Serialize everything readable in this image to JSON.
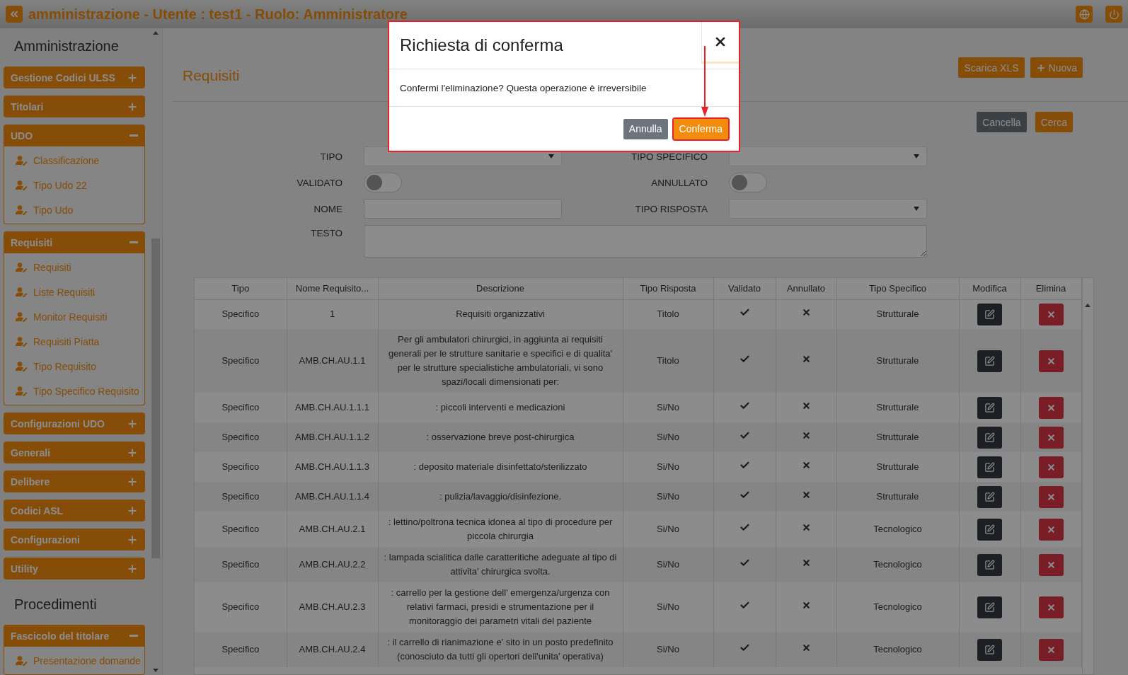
{
  "header": {
    "title": "amministrazione - Utente : test1 - Ruolo: Amministratore"
  },
  "sidebar": {
    "sections": [
      {
        "heading": "Amministrazione",
        "groups": [
          {
            "label": "Gestione Codici ULSS",
            "expanded": false
          },
          {
            "label": "Titolari",
            "expanded": false
          },
          {
            "label": "UDO",
            "expanded": true,
            "items": [
              "Classificazione",
              "Tipo Udo 22",
              "Tipo Udo"
            ]
          },
          {
            "label": "Requisiti",
            "expanded": true,
            "items": [
              "Requisiti",
              "Liste Requisiti",
              "Monitor Requisiti",
              "Requisiti Piatta",
              "Tipo Requisito",
              "Tipo Specifico Requisito"
            ]
          },
          {
            "label": "Configurazioni UDO",
            "expanded": false
          },
          {
            "label": "Generali",
            "expanded": false
          },
          {
            "label": "Delibere",
            "expanded": false
          },
          {
            "label": "Codici ASL",
            "expanded": false
          },
          {
            "label": "Configurazioni",
            "expanded": false
          },
          {
            "label": "Utility",
            "expanded": false
          }
        ]
      },
      {
        "heading": "Procedimenti",
        "groups": [
          {
            "label": "Fascicolo del titolare",
            "expanded": true,
            "items": [
              "Presentazione domande"
            ]
          }
        ]
      }
    ]
  },
  "page": {
    "title": "Requisiti",
    "actions": [
      {
        "label": "Scarica XLS",
        "kind": "plain"
      },
      {
        "label": "Nuova",
        "kind": "add"
      }
    ],
    "filter_actions": [
      {
        "label": "Cancella",
        "kind": "secondary"
      },
      {
        "label": "Cerca",
        "kind": "primary"
      }
    ],
    "filters": [
      {
        "label": "TIPO",
        "kind": "select"
      },
      {
        "label": "TIPO SPECIFICO",
        "kind": "select"
      },
      {
        "label": "VALIDATO",
        "kind": "toggle",
        "on": false
      },
      {
        "label": "ANNULLATO",
        "kind": "toggle",
        "on": false
      },
      {
        "label": "NOME",
        "kind": "text"
      },
      {
        "label": "TIPO RISPOSTA",
        "kind": "select"
      },
      {
        "label": "TESTO",
        "kind": "textarea"
      }
    ]
  },
  "table": {
    "columns": [
      "Tipo",
      "Nome Requisito...",
      "Descrizione",
      "Tipo Risposta",
      "Validato",
      "Annullato",
      "Tipo Specifico",
      "Modifica",
      "Elimina"
    ],
    "rows": [
      {
        "tipo": "Specifico",
        "nome": "1",
        "descrizione": "Requisiti organizzativi",
        "tipo_risposta": "Titolo",
        "validato": true,
        "annullato": false,
        "tipo_specifico": "Strutturale"
      },
      {
        "tipo": "Specifico",
        "nome": "AMB.CH.AU.1.1",
        "descrizione": "Per gli ambulatori chirurgici, in aggiunta ai requisiti generali per le strutture sanitarie e specifici e di qualita' per le strutture specialistiche ambulatoriali, vi sono spazi/locali dimensionati per:",
        "tipo_risposta": "Titolo",
        "validato": true,
        "annullato": false,
        "tipo_specifico": "Strutturale"
      },
      {
        "tipo": "Specifico",
        "nome": "AMB.CH.AU.1.1.1",
        "descrizione": ": piccoli interventi e medicazioni",
        "tipo_risposta": "Si/No",
        "validato": true,
        "annullato": false,
        "tipo_specifico": "Strutturale"
      },
      {
        "tipo": "Specifico",
        "nome": "AMB.CH.AU.1.1.2",
        "descrizione": ": osservazione breve post-chirurgica",
        "tipo_risposta": "Si/No",
        "validato": true,
        "annullato": false,
        "tipo_specifico": "Strutturale"
      },
      {
        "tipo": "Specifico",
        "nome": "AMB.CH.AU.1.1.3",
        "descrizione": ": deposito materiale disinfettato/sterilizzato",
        "tipo_risposta": "Si/No",
        "validato": true,
        "annullato": false,
        "tipo_specifico": "Strutturale"
      },
      {
        "tipo": "Specifico",
        "nome": "AMB.CH.AU.1.1.4",
        "descrizione": ": pulizia/lavaggio/disinfezione.",
        "tipo_risposta": "Si/No",
        "validato": true,
        "annullato": false,
        "tipo_specifico": "Strutturale"
      },
      {
        "tipo": "Specifico",
        "nome": "AMB.CH.AU.2.1",
        "descrizione": ": lettino/poltrona tecnica idonea al tipo di procedure per piccola chirurgia",
        "tipo_risposta": "Si/No",
        "validato": true,
        "annullato": false,
        "tipo_specifico": "Tecnologico"
      },
      {
        "tipo": "Specifico",
        "nome": "AMB.CH.AU.2.2",
        "descrizione": ": lampada scialitica dalle caratteritiche adeguate al tipo di attivita' chirurgica svolta.",
        "tipo_risposta": "Si/No",
        "validato": true,
        "annullato": false,
        "tipo_specifico": "Tecnologico"
      },
      {
        "tipo": "Specifico",
        "nome": "AMB.CH.AU.2.3",
        "descrizione": ": carrello per la gestione dell' emergenza/urgenza con relativi farmaci, presidi e strumentazione per il monitoraggio dei parametri vitali del paziente",
        "tipo_risposta": "Si/No",
        "validato": true,
        "annullato": false,
        "tipo_specifico": "Tecnologico"
      },
      {
        "tipo": "Specifico",
        "nome": "AMB.CH.AU.2.4",
        "descrizione": ": il carrello di rianimazione e' sito in un posto predefinito (conosciuto da tutti gli opertori dell'unita' operativa)",
        "tipo_risposta": "Si/No",
        "validato": true,
        "annullato": false,
        "tipo_specifico": "Tecnologico"
      }
    ]
  },
  "modal": {
    "title": "Richiesta di conferma",
    "message": "Confermi l'eliminazione? Questa operazione è irreversibile",
    "buttons": [
      {
        "label": "Annulla",
        "kind": "secondary",
        "highlighted": false
      },
      {
        "label": "Conferma",
        "kind": "primary",
        "highlighted": true
      }
    ]
  }
}
